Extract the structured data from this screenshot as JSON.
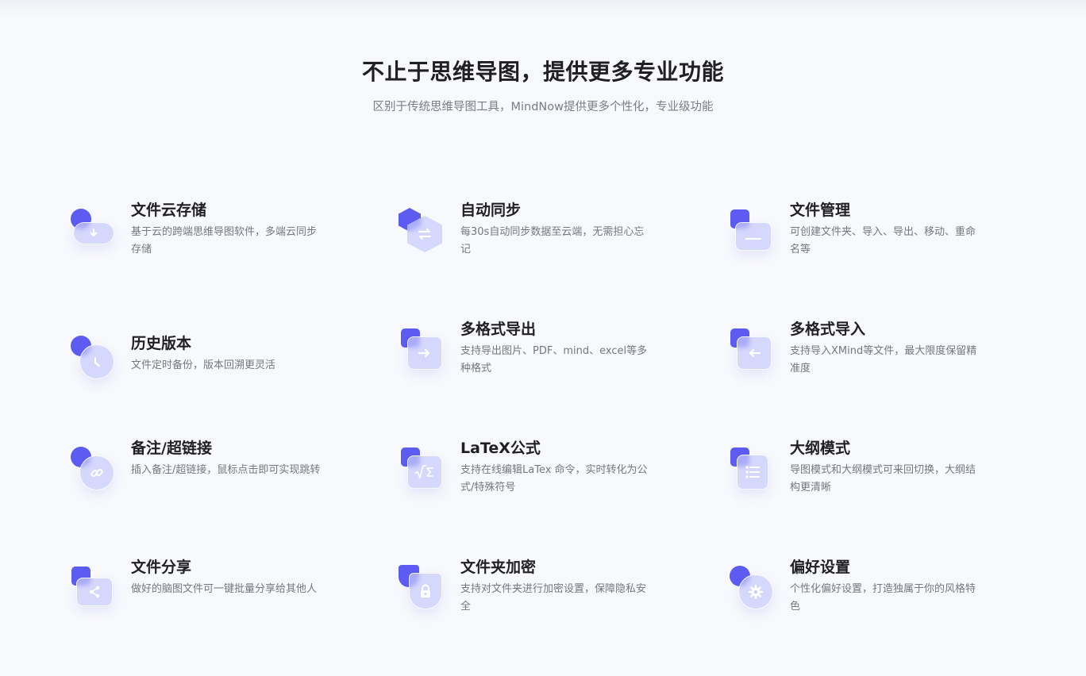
{
  "header": {
    "title": "不止于思维导图，提供更多专业功能",
    "subtitle": "区别于传统思维导图工具，MindNow提供更多个性化，专业级功能"
  },
  "features": [
    {
      "title": "文件云存储",
      "desc": "基于云的跨端思维导图软件，多端云同步存储",
      "icon": "cloud-storage-icon"
    },
    {
      "title": "自动同步",
      "desc": "每30s自动同步数据至云端，无需担心忘记",
      "icon": "auto-sync-icon"
    },
    {
      "title": "文件管理",
      "desc": "可创建文件夹、导入、导出、移动、重命名等",
      "icon": "folder-manage-icon"
    },
    {
      "title": "历史版本",
      "desc": "文件定时备份，版本回溯更灵活",
      "icon": "history-clock-icon"
    },
    {
      "title": "多格式导出",
      "desc": "支持导出图片、PDF、mind、excel等多种格式",
      "icon": "export-icon"
    },
    {
      "title": "多格式导入",
      "desc": "支持导入XMind等文件，最大限度保留精准度",
      "icon": "import-icon"
    },
    {
      "title": "备注/超链接",
      "desc": "插入备注/超链接，鼠标点击即可实现跳转",
      "icon": "link-icon"
    },
    {
      "title": "LaTeX公式",
      "desc": "支持在线编辑LaTex 命令，实时转化为公式/特殊符号",
      "icon": "formula-icon"
    },
    {
      "title": "大纲模式",
      "desc": "导图模式和大纲模式可来回切换，大纲结构更清晰",
      "icon": "outline-list-icon"
    },
    {
      "title": "文件分享",
      "desc": "做好的脑图文件可一键批量分享给其他人",
      "icon": "share-icon"
    },
    {
      "title": "文件夹加密",
      "desc": "支持对文件夹进行加密设置，保障隐私安全",
      "icon": "lock-icon"
    },
    {
      "title": "偏好设置",
      "desc": "个性化偏好设置，打造独属于你的风格特色",
      "icon": "settings-gear-icon"
    }
  ],
  "colors": {
    "accent": "#5d5cf2",
    "glass": "#c8cafc",
    "background": "#f8f9fc",
    "title": "#1f1f24",
    "desc": "#75787f"
  }
}
